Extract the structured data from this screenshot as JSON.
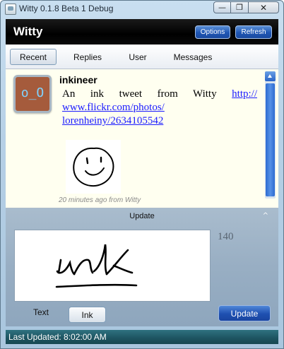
{
  "window": {
    "title": "Witty 0.1.8 Beta 1 Debug",
    "minimize_glyph": "—",
    "maximize_glyph": "❐",
    "close_glyph": "✕"
  },
  "header": {
    "app_name": "Witty",
    "options_label": "Options",
    "refresh_label": "Refresh"
  },
  "tabs": [
    {
      "label": "Recent",
      "active": true
    },
    {
      "label": "Replies",
      "active": false
    },
    {
      "label": "User",
      "active": false
    },
    {
      "label": "Messages",
      "active": false
    }
  ],
  "tweet": {
    "avatar_text": "o_O",
    "username": "inkineer",
    "text": "An ink tweet from Witty",
    "link": "http://www.flickr.com/photos/lorenheiny/2634105542",
    "link_line1": "http://",
    "link_line2": "www.flickr.com/photos/",
    "link_line3": "lorenheiny/2634105542",
    "timestamp": "20 minutes ago from Witty"
  },
  "update": {
    "label": "Update",
    "collapse_glyph": "^",
    "char_count": "140",
    "text_mode_label": "Text",
    "ink_mode_label": "Ink",
    "button_label": "Update"
  },
  "status": {
    "text": "Last Updated: 8:02:00 AM"
  },
  "colors": {
    "header_bg": "#000000",
    "accent_button": "#1f56b4",
    "status_bg": "#1d5360",
    "feed_bg": "#fffff0"
  }
}
